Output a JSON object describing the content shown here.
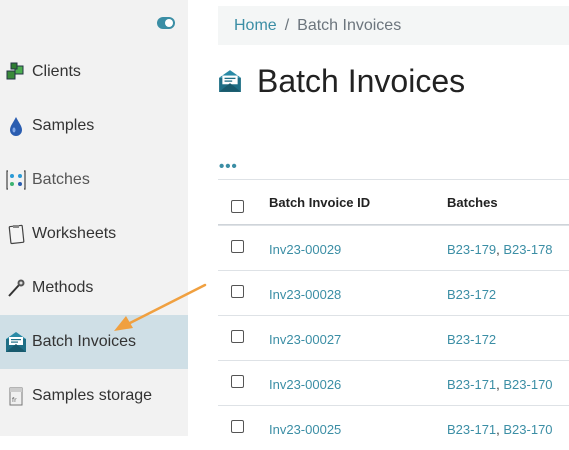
{
  "sidebar": {
    "items": [
      {
        "label": "Clients",
        "icon": "clients-icon"
      },
      {
        "label": "Samples",
        "icon": "samples-icon"
      },
      {
        "label": "Batches",
        "icon": "batches-icon"
      },
      {
        "label": "Worksheets",
        "icon": "worksheets-icon"
      },
      {
        "label": "Methods",
        "icon": "methods-icon"
      },
      {
        "label": "Batch Invoices",
        "icon": "batch-invoice-icon",
        "active": true
      },
      {
        "label": "Samples storage",
        "icon": "samples-storage-icon"
      }
    ]
  },
  "breadcrumb": {
    "home": "Home",
    "separator": "/",
    "current": "Batch Invoices"
  },
  "page": {
    "title": "Batch Invoices",
    "more": "•••"
  },
  "table": {
    "headers": {
      "id": "Batch Invoice ID",
      "batches": "Batches"
    },
    "rows": [
      {
        "id": "Inv23-00029",
        "b1": "B23-179",
        "sep": ", ",
        "b2": "B23-178"
      },
      {
        "id": "Inv23-00028",
        "b1": "B23-172",
        "sep": "",
        "b2": ""
      },
      {
        "id": "Inv23-00027",
        "b1": "B23-172",
        "sep": "",
        "b2": ""
      },
      {
        "id": "Inv23-00026",
        "b1": "B23-171",
        "sep": ", ",
        "b2": "B23-170"
      },
      {
        "id": "Inv23-00025",
        "b1": "B23-171",
        "sep": ", ",
        "b2": "B23-170"
      }
    ]
  },
  "colors": {
    "accent": "#3b8ea5",
    "active_bg": "#cfdfe6",
    "arrow": "#f0a040"
  }
}
